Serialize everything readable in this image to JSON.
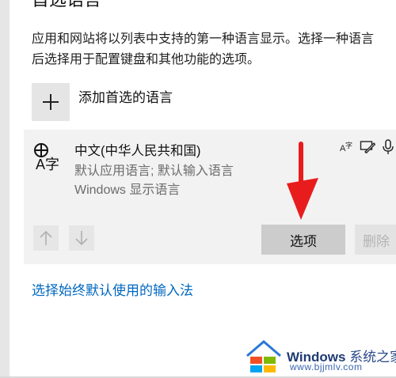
{
  "section": {
    "heading": "首选语言",
    "description_line1": "应用和网站将以列表中支持的第一种语言显示。选择一种语言",
    "description_line2": "后选择用于配置键盘和其他功能的选项。"
  },
  "add_language": {
    "label": "添加首选的语言",
    "icon": "plus-icon"
  },
  "language_card": {
    "icon": "language-icon",
    "icon_glyph": "A字",
    "name": "中文(中华人民共和国)",
    "subtitle_1": "默认应用语言; 默认输入语言",
    "subtitle_2": "Windows 显示语言",
    "feature_icons": [
      "text-to-speech-icon",
      "handwriting-icon",
      "microphone-icon"
    ],
    "move_up_icon": "arrow-up-icon",
    "move_down_icon": "arrow-down-icon",
    "options_label": "选项",
    "remove_label": "删除"
  },
  "link": {
    "label": "选择始终默认使用的输入法"
  },
  "annotation": {
    "arrow_color": "#e81c1c"
  },
  "watermark": {
    "brand": "Windows",
    "brand_suffix": "系统之家",
    "url": "www.bjjmlv.com"
  },
  "colors": {
    "link": "#0067c0",
    "card_bg": "#f2f2f2",
    "button_bg": "#cccccc"
  }
}
